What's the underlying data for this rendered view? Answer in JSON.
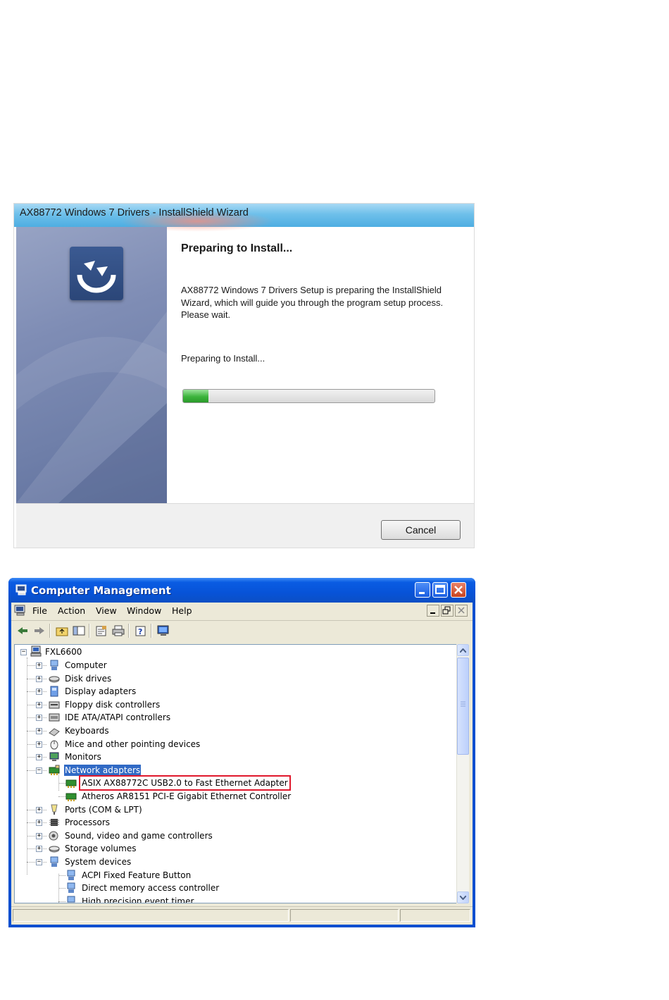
{
  "installshield": {
    "title": "AX88772  Windows 7 Drivers - InstallShield Wizard",
    "heading": "Preparing to Install...",
    "description": "AX88772 Windows 7 Drivers Setup is preparing the InstallShield Wizard, which will guide you through the program setup process.  Please wait.",
    "status": "Preparing to Install...",
    "progress_fraction": 0.1,
    "cancel_label": "Cancel"
  },
  "computer_management": {
    "title": "Computer Management",
    "menu": [
      "File",
      "Action",
      "View",
      "Window",
      "Help"
    ],
    "toolbar_icons": [
      "back-arrow-icon",
      "forward-arrow-icon",
      "up-folder-icon",
      "show-hide-tree-icon",
      "properties-icon",
      "print-icon",
      "help-icon",
      "monitor-icon"
    ],
    "tree": {
      "root": "FXL6600",
      "items": [
        {
          "label": "Computer",
          "icon": "computer-icon",
          "expanded": false
        },
        {
          "label": "Disk drives",
          "icon": "disk-drive-icon",
          "expanded": false
        },
        {
          "label": "Display adapters",
          "icon": "display-adapter-icon",
          "expanded": false
        },
        {
          "label": "Floppy disk controllers",
          "icon": "floppy-controller-icon",
          "expanded": false
        },
        {
          "label": "IDE ATA/ATAPI controllers",
          "icon": "ide-controller-icon",
          "expanded": false
        },
        {
          "label": "Keyboards",
          "icon": "keyboard-icon",
          "expanded": false
        },
        {
          "label": "Mice and other pointing devices",
          "icon": "mouse-icon",
          "expanded": false
        },
        {
          "label": "Monitors",
          "icon": "monitor-icon",
          "expanded": false
        },
        {
          "label": "Network adapters",
          "icon": "network-adapter-icon",
          "expanded": true,
          "selected": true
        },
        {
          "label": "ASIX AX88772C USB2.0 to Fast Ethernet Adapter",
          "icon": "network-card-icon",
          "child": true,
          "highlighted": true
        },
        {
          "label": "Atheros AR8151 PCI-E Gigabit Ethernet Controller",
          "icon": "network-card-icon",
          "child": true
        },
        {
          "label": "Ports (COM & LPT)",
          "icon": "port-icon",
          "expanded": false
        },
        {
          "label": "Processors",
          "icon": "processor-icon",
          "expanded": false
        },
        {
          "label": "Sound, video and game controllers",
          "icon": "sound-icon",
          "expanded": false
        },
        {
          "label": "Storage volumes",
          "icon": "storage-icon",
          "expanded": false
        },
        {
          "label": "System devices",
          "icon": "system-devices-icon",
          "expanded": true
        },
        {
          "label": "ACPI Fixed Feature Button",
          "icon": "system-device-icon",
          "child": true
        },
        {
          "label": "Direct memory access controller",
          "icon": "system-device-icon",
          "child": true
        },
        {
          "label": "High precision event timer",
          "icon": "system-device-icon",
          "child": true
        }
      ]
    },
    "colors": {
      "selection": "#316ac5",
      "highlight_box": "#e0182c",
      "titlebar": "#0a5ce3"
    }
  }
}
